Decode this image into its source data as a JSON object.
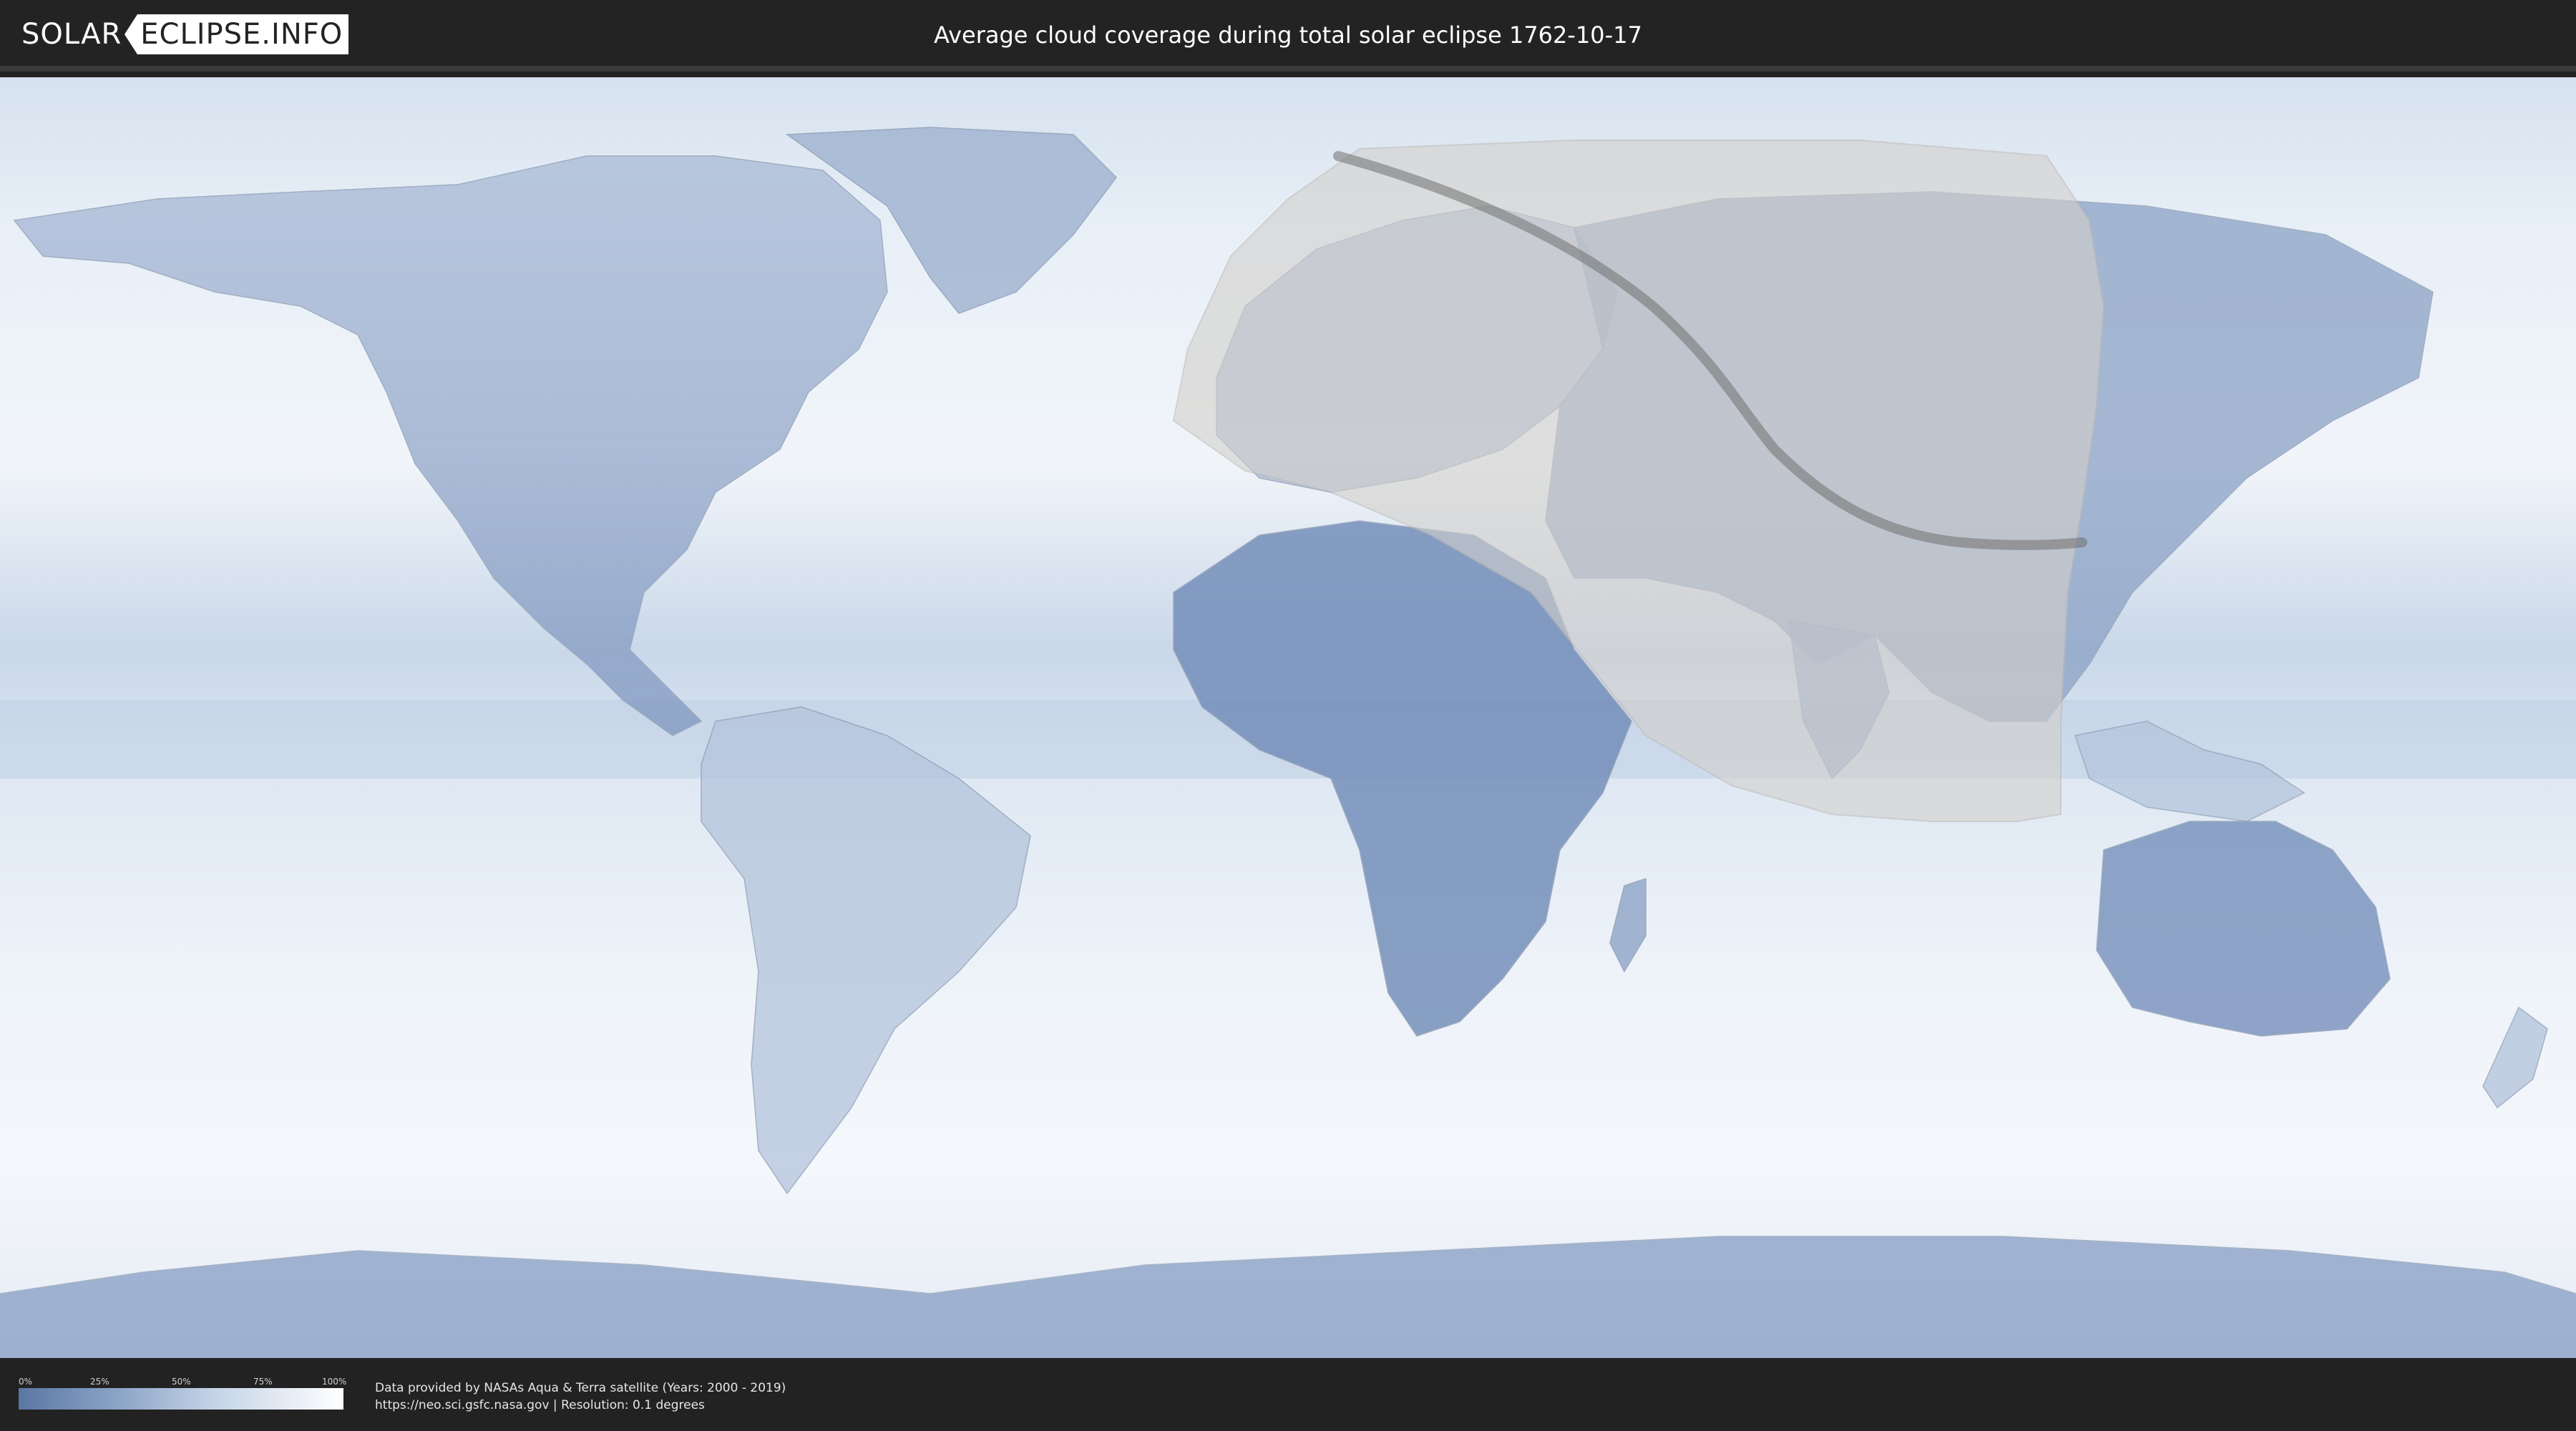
{
  "header": {
    "logo_part1": "SOLAR",
    "logo_part2": "ECLIPSE.INFO",
    "title": "Average cloud coverage during total solar eclipse 1762-10-17"
  },
  "legend": {
    "ticks": [
      "0%",
      "25%",
      "50%",
      "75%",
      "100%"
    ],
    "tick_values": [
      0,
      25,
      50,
      75,
      100
    ],
    "colors": {
      "low": "#5a76a3",
      "high": "#ffffff"
    }
  },
  "credits": {
    "line1": "Data provided by NASAs Aqua & Terra satellite (Years: 2000 - 2019)",
    "link": "https://neo.sci.gsfc.nasa.gov",
    "separator": " | ",
    "resolution": "Resolution: 0.1 degrees"
  },
  "colors": {
    "bar_background": "#232323",
    "ocean_cloud": "#e9f0f8",
    "land_dark": "#6b86b2",
    "shadow_zone": "#c8c8c8",
    "eclipse_path": "#7a7a7a"
  }
}
